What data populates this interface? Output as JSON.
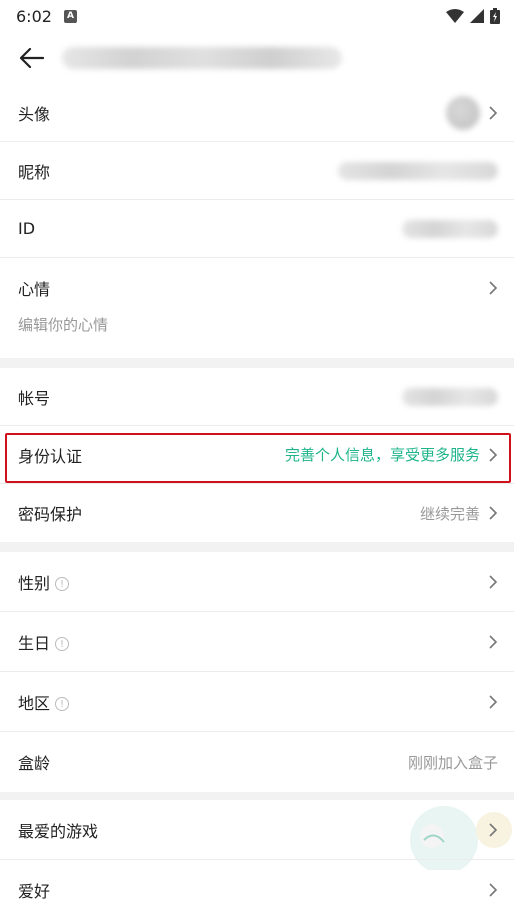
{
  "status": {
    "time": "6:02",
    "a_badge": "A"
  },
  "header": {
    "back_icon": "arrow-left-icon"
  },
  "profile": {
    "avatar_label": "头像",
    "nickname_label": "昵称",
    "id_label": "ID",
    "mood_label": "心情",
    "mood_placeholder": "编辑你的心情"
  },
  "account": {
    "account_label": "帐号",
    "identity_label": "身份认证",
    "identity_value": "完善个人信息，享受更多服务",
    "password_label": "密码保护",
    "password_value": "继续完善"
  },
  "personal": {
    "gender_label": "性别",
    "birthday_label": "生日",
    "region_label": "地区",
    "age_label": "盒龄",
    "age_value": "刚刚加入盒子"
  },
  "prefs": {
    "fav_games_label": "最爱的游戏",
    "hobby_label": "爱好"
  },
  "colors": {
    "accent_green": "#1fb48a",
    "highlight_red": "#d0101d"
  }
}
